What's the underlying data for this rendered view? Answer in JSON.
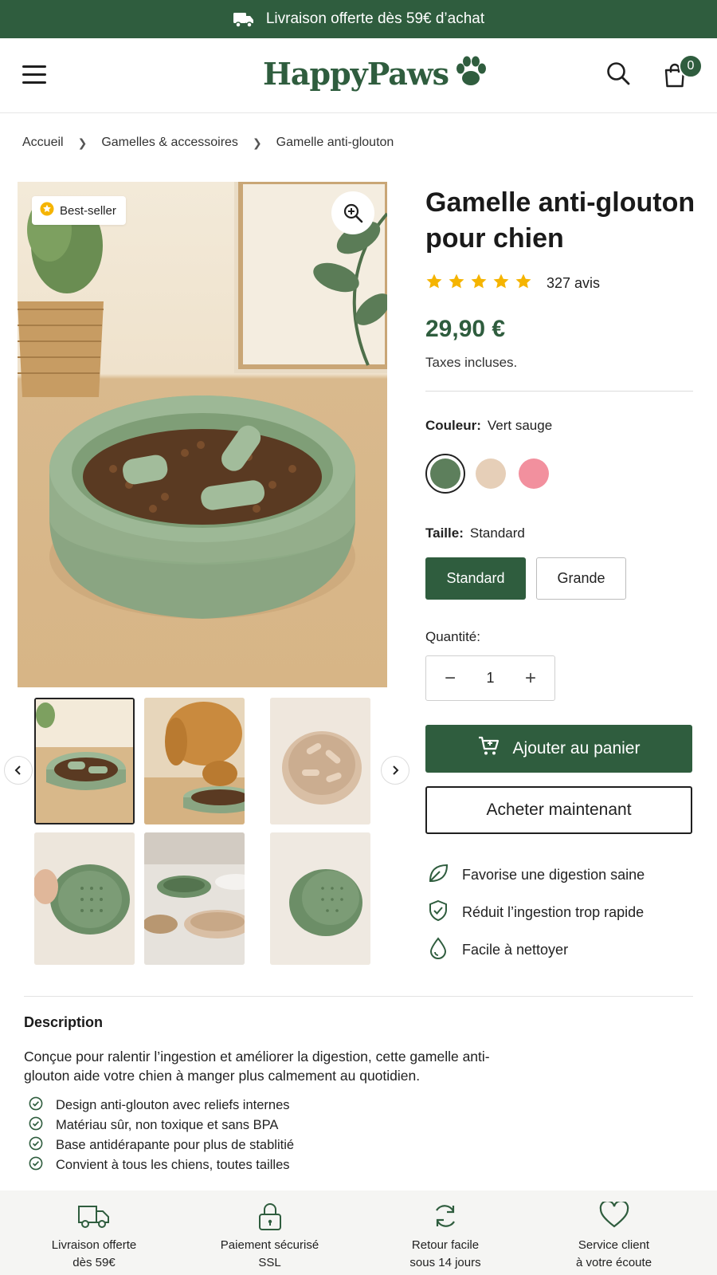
{
  "promo": {
    "text": "Livraison offerte dès 59€ d’achat",
    "icon": "truck-icon"
  },
  "header": {
    "logo": "HappyPaws",
    "cart_count": "0",
    "icons": [
      "menu-icon",
      "paw-icon",
      "search-icon",
      "shopping-bag-icon"
    ]
  },
  "breadcrumb": [
    "Accueil",
    "Gamelles & accessoires",
    "Gamelle anti-glouton"
  ],
  "gallery": {
    "badge": "Best-seller",
    "badge_icon": "star-badge-icon",
    "zoom_icon": "zoom-in-icon",
    "thumbnail_count": 6,
    "selected_thumbnail": 1
  },
  "product": {
    "title": "Gamelle anti-glouton pour chien",
    "rating": 5,
    "reviews": "327 avis",
    "price": "29,90 €",
    "tax_note": "Taxes incluses."
  },
  "options": {
    "color_label": "Couleur:",
    "color_value": "Vert sauge",
    "colors": [
      "#5d7f5c",
      "#e6cfb8",
      "#f2909e"
    ],
    "size_label": "Taille:",
    "size_value": "Standard",
    "sizes": [
      "Standard",
      "Grande"
    ],
    "quantity_label": "Quantité:",
    "quantity": "1"
  },
  "actions": {
    "add_to_cart": "Ajouter au panier",
    "buy_now": "Acheter maintenant"
  },
  "features": [
    {
      "text": "Favorise une digestion saine",
      "icon": "leaf-icon"
    },
    {
      "text": "Réduit l’ingestion trop rapide",
      "icon": "shield-check-icon"
    },
    {
      "text": "Facile à nettoyer",
      "icon": "water-drop-icon"
    }
  ],
  "description": {
    "title": "Description",
    "text": "Conçue pour ralentir l’ingestion et améliorer la digestion, cette gamelle anti-glouton aide votre chien à manger plus calmement au quotidien.",
    "bullets": [
      "Design anti-glouton avec reliefs internes",
      "Matériau sûr, non toxique et sans BPA",
      "Base antidérapante pour plus de stablitié",
      "Convient à tous les chiens, toutes tailles"
    ]
  },
  "footer": [
    {
      "line1": "Livraison offerte",
      "line2": "dès 59€",
      "icon": "truck-icon"
    },
    {
      "line1": "Paiement sécurisé",
      "line2": "SSL",
      "icon": "lock-icon"
    },
    {
      "line1": "Retour facile",
      "line2": "sous 14 jours",
      "icon": "refresh-icon"
    },
    {
      "line1": "Service client",
      "line2": "à votre écoute",
      "icon": "heart-icon"
    }
  ],
  "colors": {
    "brand": "#2f5d3e",
    "star": "#f5b400"
  }
}
